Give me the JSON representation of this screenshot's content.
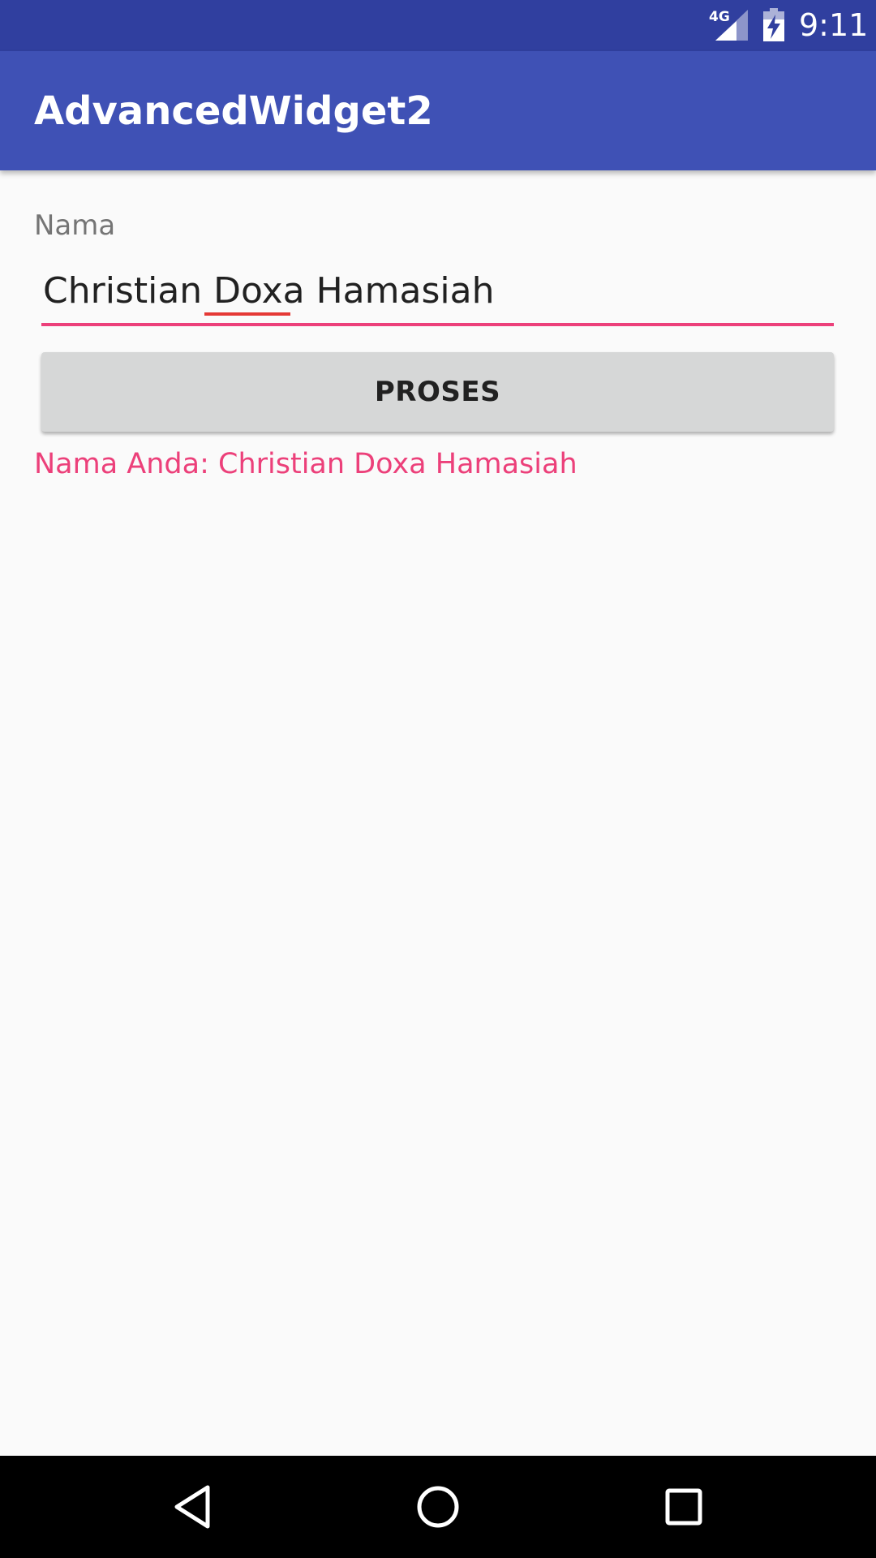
{
  "status_bar": {
    "network_label": "4G",
    "time": "9:11",
    "icons": [
      "signal-icon",
      "battery-charging-icon"
    ],
    "background": "#303f9f"
  },
  "app_bar": {
    "title": "AdvancedWidget2",
    "background": "#3f51b5"
  },
  "form": {
    "field_label": "Nama",
    "name_value": "Christian Doxa Hamasiah",
    "accent": "#ec407a",
    "button_label": "PROSES",
    "result_text": "Nama Anda: Christian Doxa Hamasiah"
  },
  "nav_bar": {
    "icons": [
      "back-icon",
      "home-icon",
      "recent-apps-icon"
    ]
  }
}
